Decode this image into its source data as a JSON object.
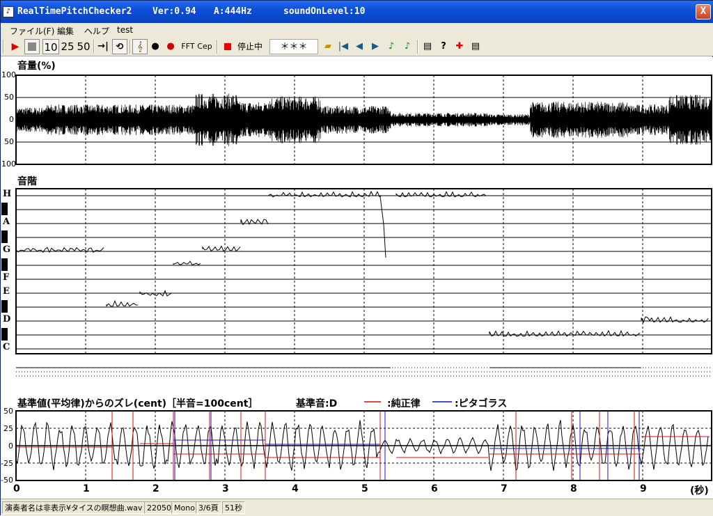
{
  "window": {
    "title_app": "RealTimePitchChecker2",
    "title_version": "Ver:0.94",
    "title_a": "A:444Hz",
    "title_level": "soundOnLevel:10",
    "close_label": "X"
  },
  "menu": [
    "ファイル(F)",
    "編集",
    "ヘルプ",
    "test"
  ],
  "toolbar": {
    "btn_10": "10",
    "btn_25": "25",
    "btn_50": "50",
    "fft": "FFT",
    "cep": "Cep",
    "status": "停止中",
    "note_display": "＊＊＊"
  },
  "volume_panel": {
    "title": "音量(%)",
    "y_labels": [
      "100",
      "50",
      "0",
      "50",
      "100"
    ]
  },
  "scale_panel": {
    "title": "音階",
    "notes": [
      "H",
      "A",
      "G",
      "F",
      "E",
      "D",
      "C"
    ]
  },
  "cent_panel": {
    "title": "基準値(平均律)からのズレ(cent)［半音=100cent］",
    "base_note": "基準音:D",
    "legend_just": ":純正律",
    "legend_pyth": ":ピタゴラス",
    "just_color": "#d01010",
    "pyth_color": "#1010c0",
    "y_labels": [
      "50",
      "25",
      "0",
      "-25",
      "-50"
    ]
  },
  "x_axis": {
    "ticks": [
      "0",
      "1",
      "2",
      "3",
      "4",
      "5",
      "6",
      "7",
      "8",
      "9"
    ],
    "unit": "(秒)"
  },
  "statusbar": {
    "file": "演奏者名は非表示¥タイスの瞑想曲.wav",
    "rate": "22050",
    "channels": "Mono",
    "page": "3/6頁",
    "duration": "51秒"
  }
}
